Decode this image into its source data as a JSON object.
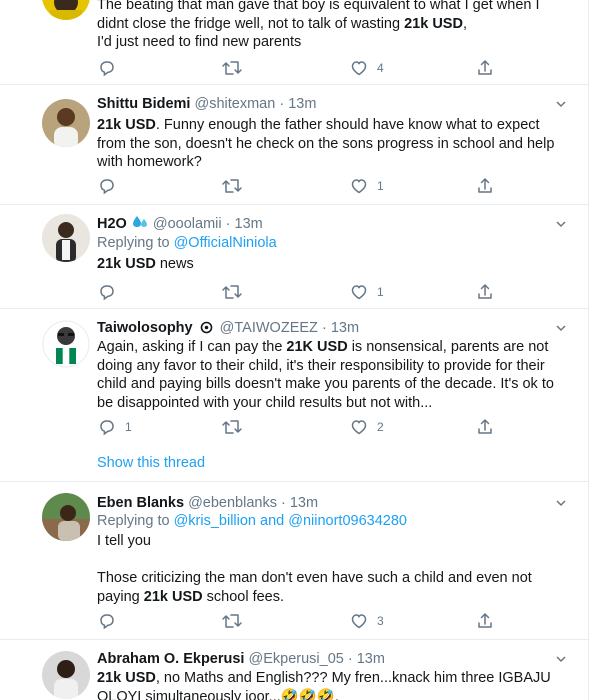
{
  "tweets": [
    {
      "id": "t0",
      "text_parts": [
        "The beating that man gave that boy is equivalent to what I get when I didnt close the fridge well, not to talk of wasting ",
        "21k USD",
        ",",
        "I'd just need to find new parents"
      ],
      "likes": "4"
    },
    {
      "id": "t1",
      "name": "Shittu Bidemi",
      "handle": "@shitexman",
      "dot": "·",
      "time": "13m",
      "text_parts": [
        "21k USD",
        ". Funny enough the father should have know what to expect from the son, doesn't he check on the sons progress in school and help with homework?"
      ],
      "likes": "1"
    },
    {
      "id": "t2",
      "name": "H2O",
      "handle": "@ooolamii",
      "dot": "·",
      "time": "13m",
      "replying_label": "Replying to ",
      "replying_to": "@OfficialNiniola",
      "text_parts": [
        "21k USD",
        " news"
      ],
      "likes": "1"
    },
    {
      "id": "t3",
      "name": "Taiwolosophy",
      "handle": "@TAIWOZEEZ",
      "dot": "·",
      "time": "13m",
      "text_parts": [
        "Again, asking if I can pay the ",
        "21K USD",
        " is nonsensical, parents are not doing any favor to their child, it's their responsibility to provide for their child and paying bills doesn't make you parents of the decade. It's ok to be disappointed with your child results but not with..."
      ],
      "replies": "1",
      "likes": "2",
      "show_thread": "Show this thread"
    },
    {
      "id": "t4",
      "name": "Eben Blanks",
      "handle": "@ebenblanks",
      "dot": "·",
      "time": "13m",
      "replying_label": "Replying to ",
      "replying_to": "@kris_billion",
      "replying_and": " and ",
      "replying_to2": "@niinort09634280",
      "text_parts": [
        "I tell you",
        "Those criticizing the man don't even have such a child and even not paying ",
        "21k USD",
        " school fees."
      ],
      "likes": "3"
    },
    {
      "id": "t5",
      "name": "Abraham O. Ekperusi",
      "handle": "@Ekperusi_05",
      "dot": "·",
      "time": "13m",
      "text_parts": [
        "21k USD",
        ", no Maths and English??? My fren...knack him three IGBAJU OLOYI simultaneously joor...",
        "🤣🤣🤣",
        "."
      ]
    }
  ],
  "colors": {
    "accent": "#1da1f2",
    "muted": "#657786",
    "text": "#14171a",
    "divider": "#e6ecf0",
    "nigeria_green": "#008751"
  }
}
